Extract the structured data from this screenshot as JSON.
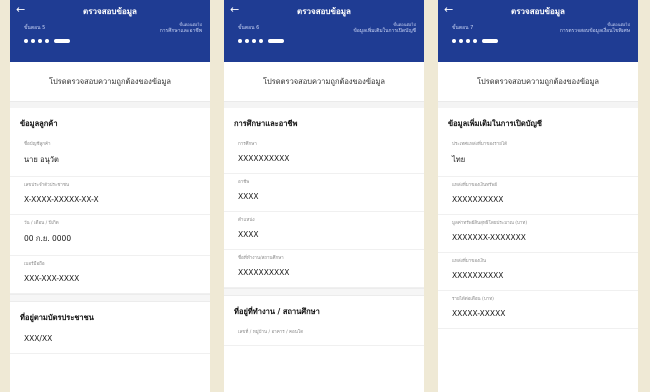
{
  "screens": [
    {
      "header": {
        "title": "ตรวจสอบข้อมูล",
        "step": "ขั้นตอน 5",
        "progress_top": "ขั้นตอนต่อไป",
        "progress_bottom": "การศึกษาและอาชีพ"
      },
      "notice": "โปรดตรวจสอบความถูกต้องของข้อมูล",
      "sections": [
        {
          "title": "ข้อมูลลูกค้า",
          "fields": [
            {
              "label": "ชื่อบัญชีลูกค้า",
              "value": "นาย อนุวัต"
            },
            {
              "label": "เลขประจำตัวประชาชน",
              "value": "X-XXXX-XXXXX-XX-X"
            },
            {
              "label": "วัน / เดือน / ปีเกิด",
              "value": "00 ก.ย. 0000"
            },
            {
              "label": "เบอร์มือถือ",
              "value": "XXX-XXX-XXXX"
            }
          ]
        },
        {
          "title": "ที่อยู่ตามบัตรประชาชน",
          "fields": [
            {
              "label": "",
              "value": "XXX/XX"
            }
          ]
        }
      ]
    },
    {
      "header": {
        "title": "ตรวจสอบข้อมูล",
        "step": "ขั้นตอน 6",
        "progress_top": "ขั้นตอนต่อไป",
        "progress_bottom": "ข้อมูลเพิ่มเติมในการเปิดบัญชี"
      },
      "notice": "โปรดตรวจสอบความถูกต้องของข้อมูล",
      "sections": [
        {
          "title": "การศึกษาและอาชีพ",
          "fields": [
            {
              "label": "การศึกษา",
              "value": "XXXXXXXXXX"
            },
            {
              "label": "อาชีพ",
              "value": "XXXX"
            },
            {
              "label": "ตำแหน่ง",
              "value": "XXXX"
            },
            {
              "label": "ชื่อที่ทำงาน/สถานศึกษา",
              "value": "XXXXXXXXXX"
            }
          ]
        },
        {
          "title": "ที่อยู่ที่ทำงาน / สถานศึกษา",
          "fields": [
            {
              "label": "เลขที่ / หมู่บ้าน / อาคาร / คอนโด",
              "value": ""
            }
          ]
        }
      ]
    },
    {
      "header": {
        "title": "ตรวจสอบข้อมูล",
        "step": "ขั้นตอน 7",
        "progress_top": "ขั้นตอนต่อไป",
        "progress_bottom": "การตรวจสอบข้อมูลเงื่อนไขพิเศษ"
      },
      "notice": "โปรดตรวจสอบความถูกต้องของข้อมูล",
      "sections": [
        {
          "title": "ข้อมูลเพิ่มเติมในการเปิดบัญชี",
          "fields": [
            {
              "label": "ประเทศแหล่งที่มาของรายได้",
              "value": "ไทย"
            },
            {
              "label": "แหล่งที่มาของเงินทรัพย์",
              "value": "XXXXXXXXXX"
            },
            {
              "label": "มูลค่าทรัพย์สินสุทธิโดยประมาณ (บาท)",
              "value": "XXXXXXX-XXXXXXX"
            },
            {
              "label": "แหล่งที่มาของเงิน",
              "value": "XXXXXXXXXX"
            },
            {
              "label": "รายได้ต่อเดือน (บาท)",
              "value": "XXXXX-XXXXX"
            }
          ]
        }
      ]
    }
  ]
}
